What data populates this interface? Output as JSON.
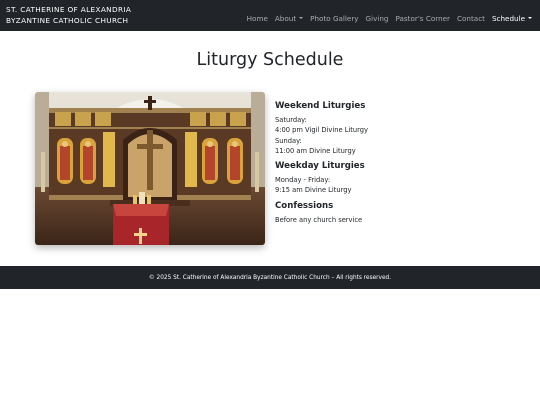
{
  "navbar": {
    "brand_line1": "ST. CATHERINE OF ALEXANDRIA",
    "brand_line2": "BYZANTINE CATHOLIC CHURCH",
    "items": [
      {
        "label": "Home"
      },
      {
        "label": "About",
        "dropdown": true
      },
      {
        "label": "Photo Gallery"
      },
      {
        "label": "Giving"
      },
      {
        "label": "Pastor's Corner"
      },
      {
        "label": "Contact"
      },
      {
        "label": "Schedule",
        "dropdown": true,
        "active": true
      }
    ]
  },
  "main": {
    "title": "Liturgy Schedule",
    "image_icon": "church-iconostasis-photo",
    "sections": [
      {
        "heading": "Weekend Liturgies",
        "lines": [
          "Saturday:",
          "4:00 pm Vigil Divine Liturgy",
          "Sunday:",
          "11:00 am Divine Liturgy"
        ]
      },
      {
        "heading": "Weekday Liturgies",
        "lines": [
          "Monday - Friday:",
          "9:15 am Divine Liturgy"
        ]
      },
      {
        "heading": "Confessions",
        "lines": [
          "Before any church service"
        ]
      }
    ]
  },
  "footer": {
    "text": "© 2025 St. Catherine of Alexandria Byzantine Catholic Church – All rights reserved."
  },
  "colors": {
    "navbar_bg": "#212529",
    "nav_link": "rgba(255,255,255,0.6)",
    "nav_link_active": "#ffffff",
    "text": "#212529",
    "background": "#ffffff"
  }
}
